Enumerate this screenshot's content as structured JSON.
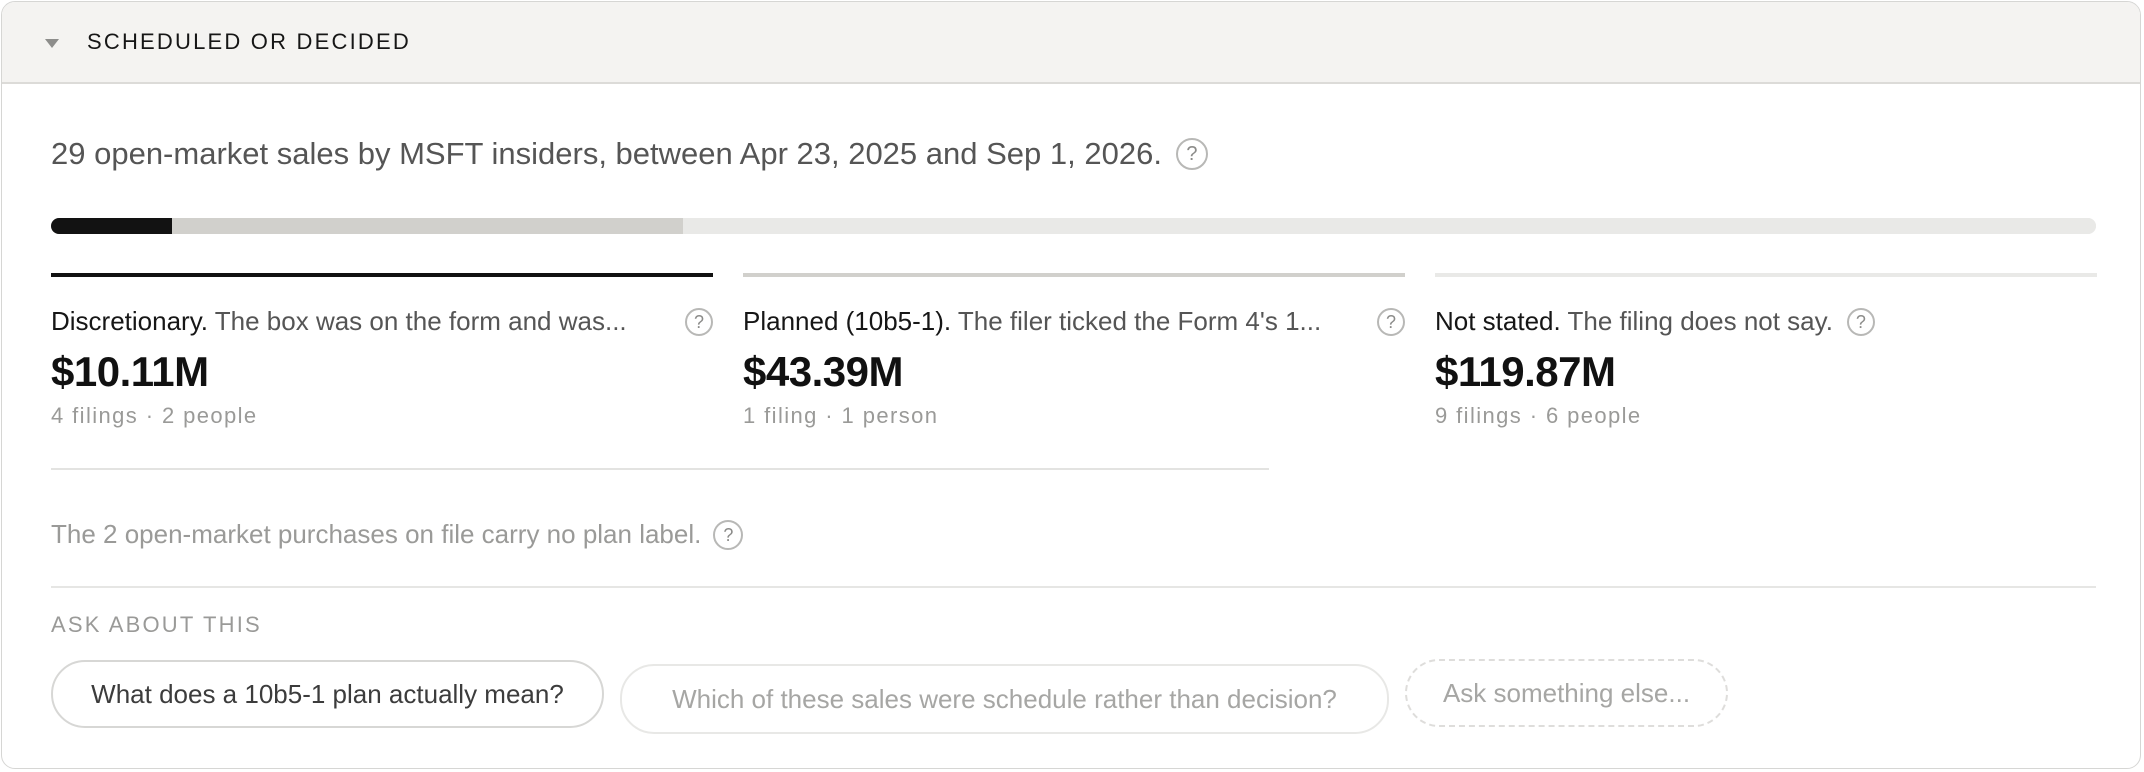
{
  "section": {
    "title": "SCHEDULED OR DECIDED",
    "caret_icon": "caret-down-icon"
  },
  "summary": {
    "text": "29 open-market sales by MSFT insiders, between Apr 23, 2025 and Sep 1, 2026.",
    "help": "?"
  },
  "breakdown_bar": {
    "segments": [
      {
        "name": "discretionary",
        "fraction": 0.059,
        "color": "#121212"
      },
      {
        "name": "planned",
        "fraction": 0.25,
        "color": "#d1d0cc"
      },
      {
        "name": "not_stated",
        "fraction": 0.691,
        "color": "#e9e9e7"
      }
    ]
  },
  "categories": [
    {
      "strong": "Discretionary.",
      "desc": " The box was on the form and was...",
      "help": "?",
      "amount": "$10.11M",
      "meta": "4 filings · 2 people",
      "rule_color": "#111111"
    },
    {
      "strong": "Planned (10b5-1).",
      "desc": " The filer ticked the Form 4's 1...",
      "help": "?",
      "amount": "$43.39M",
      "meta": "1 filing · 1 person",
      "rule_color": "#d1d0cc"
    },
    {
      "strong": "Not stated.",
      "desc": " The filing does not say.",
      "help": "?",
      "amount": "$119.87M",
      "meta": "9 filings · 6 people",
      "rule_color": "#e9e9e7"
    }
  ],
  "purchases_note": {
    "text": "The 2 open-market purchases on file carry no plan label.",
    "help": "?"
  },
  "ask": {
    "heading": "ASK ABOUT THIS",
    "chips": [
      "What does a 10b5-1 plan actually mean?",
      "Which of these sales were schedule rather than decision?"
    ],
    "input_placeholder": "Ask something else..."
  }
}
